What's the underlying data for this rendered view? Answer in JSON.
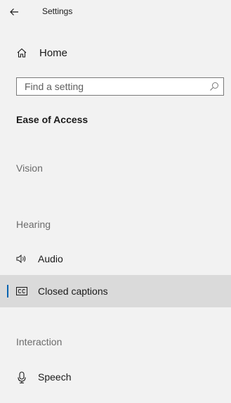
{
  "window": {
    "title": "Settings",
    "back_icon": "back-arrow-icon"
  },
  "home": {
    "label": "Home",
    "icon": "home-icon"
  },
  "search": {
    "placeholder": "Find a setting",
    "value": "",
    "icon": "search-icon"
  },
  "category": {
    "title": "Ease of Access"
  },
  "groups": {
    "vision": "Vision",
    "hearing": "Hearing",
    "interaction": "Interaction"
  },
  "nav": {
    "audio": {
      "label": "Audio",
      "icon": "speaker-icon",
      "selected": false
    },
    "closed_captions": {
      "label": "Closed captions",
      "icon": "closed-captions-icon",
      "selected": true
    },
    "speech": {
      "label": "Speech",
      "icon": "microphone-icon",
      "selected": false
    }
  },
  "colors": {
    "background": "#f2f2f2",
    "selected_background": "#dadada",
    "accent": "#0063b1",
    "group_label": "#6b6b6b"
  }
}
